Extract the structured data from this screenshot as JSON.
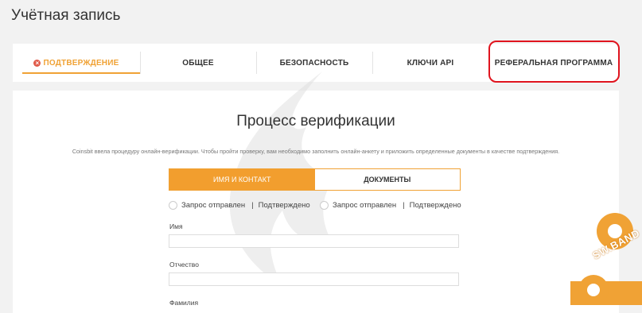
{
  "page": {
    "title": "Учётная запись"
  },
  "tabs": [
    {
      "label": "ПОДТВЕРЖДЕНИЕ",
      "icon": "error-icon",
      "active": true
    },
    {
      "label": "ОБЩЕЕ",
      "active": false
    },
    {
      "label": "БЕЗОПАСНОСТЬ",
      "active": false
    },
    {
      "label": "КЛЮЧИ API",
      "active": false
    },
    {
      "label": "РЕФЕРАЛЬНАЯ ПРОГРАММА",
      "active": false
    }
  ],
  "verification": {
    "title": "Процесс верификации",
    "intro": "Coinsbit ввела процедуру онлайн-верификации. Чтобы пройти проверку, вам необходимо заполнить онлайн-анкету и приложить определенные документы в качестве подтверждения.",
    "steps": [
      {
        "label": "ИМЯ И КОНТАКТ",
        "active": true
      },
      {
        "label": "ДОКУМЕНТЫ",
        "active": false
      }
    ],
    "statuses": [
      {
        "sent": "Запрос отправлен",
        "confirmed": "Подтверждено"
      },
      {
        "sent": "Запрос отправлен",
        "confirmed": "Подтверждено"
      }
    ],
    "fields": [
      {
        "label": "Имя",
        "value": ""
      },
      {
        "label": "Отчество",
        "value": ""
      },
      {
        "label": "Фамилия",
        "value": ""
      }
    ]
  },
  "watermark": {
    "text": "SW.BAND"
  },
  "colors": {
    "accent": "#f0a235",
    "highlight": "#e0141e",
    "error": "#e05b4a"
  }
}
